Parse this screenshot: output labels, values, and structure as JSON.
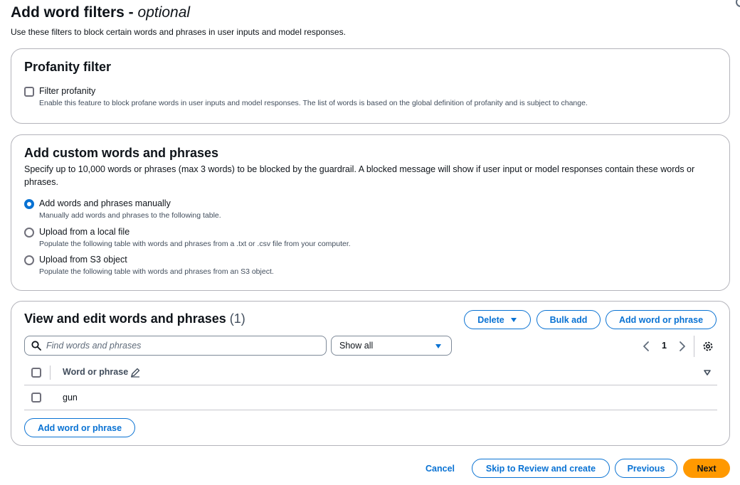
{
  "header": {
    "title": "Add word filters -",
    "title_optional": "optional",
    "description": "Use these filters to block certain words and phrases in user inputs and model responses."
  },
  "profanity": {
    "title": "Profanity filter",
    "checkbox_label": "Filter profanity",
    "checkbox_description": "Enable this feature to block profane words in user inputs and model responses. The list of words is based on the global definition of profanity and is subject to change.",
    "checked": false
  },
  "custom": {
    "title": "Add custom words and phrases",
    "description": "Specify up to 10,000 words or phrases (max 3 words) to be blocked by the guardrail. A blocked message will show if user input or model responses contain these words or phrases.",
    "options": [
      {
        "label": "Add words and phrases manually",
        "description": "Manually add words and phrases to the following table.",
        "selected": true
      },
      {
        "label": "Upload from a local file",
        "description": "Populate the following table with words and phrases from a .txt or .csv file from your computer.",
        "selected": false
      },
      {
        "label": "Upload from S3 object",
        "description": "Populate the following table with words and phrases from an S3 object.",
        "selected": false
      }
    ]
  },
  "table": {
    "title": "View and edit words and phrases",
    "count": "(1)",
    "delete_label": "Delete",
    "bulk_add_label": "Bulk add",
    "add_label": "Add word or phrase",
    "search_placeholder": "Find words and phrases",
    "filter_value": "Show all",
    "page": "1",
    "column_header": "Word or phrase",
    "rows": [
      {
        "word": "gun"
      }
    ],
    "add_bottom_label": "Add word or phrase"
  },
  "footer": {
    "cancel_label": "Cancel",
    "skip_label": "Skip to Review and create",
    "previous_label": "Previous",
    "next_label": "Next"
  },
  "colors": {
    "accent": "#0972d3",
    "primary_button": "#ff9900",
    "border": "#b4b4bb"
  },
  "icons": [
    "search-icon",
    "caret-down-icon",
    "chevron-left-icon",
    "chevron-right-icon",
    "settings-icon",
    "edit-icon",
    "sort-icon"
  ]
}
